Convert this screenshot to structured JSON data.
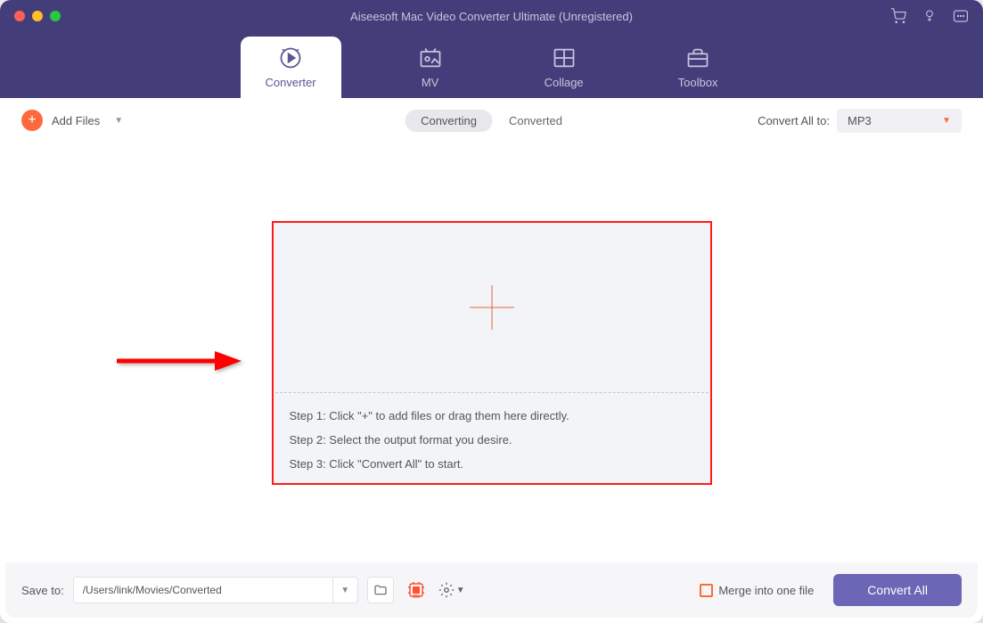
{
  "window": {
    "title": "Aiseesoft Mac Video Converter Ultimate (Unregistered)"
  },
  "nav": {
    "tabs": [
      {
        "label": "Converter"
      },
      {
        "label": "MV"
      },
      {
        "label": "Collage"
      },
      {
        "label": "Toolbox"
      }
    ]
  },
  "toolbar": {
    "add_files_label": "Add Files",
    "segments": {
      "converting": "Converting",
      "converted": "Converted"
    },
    "convert_all_to_label": "Convert All to:",
    "format_value": "MP3"
  },
  "dropzone": {
    "steps": [
      "Step 1: Click \"+\" to add files or drag them here directly.",
      "Step 2: Select the output format you desire.",
      "Step 3: Click \"Convert All\" to start."
    ]
  },
  "footer": {
    "save_to_label": "Save to:",
    "save_path": "/Users/link/Movies/Converted",
    "merge_label": "Merge into one file",
    "convert_all_label": "Convert All"
  }
}
